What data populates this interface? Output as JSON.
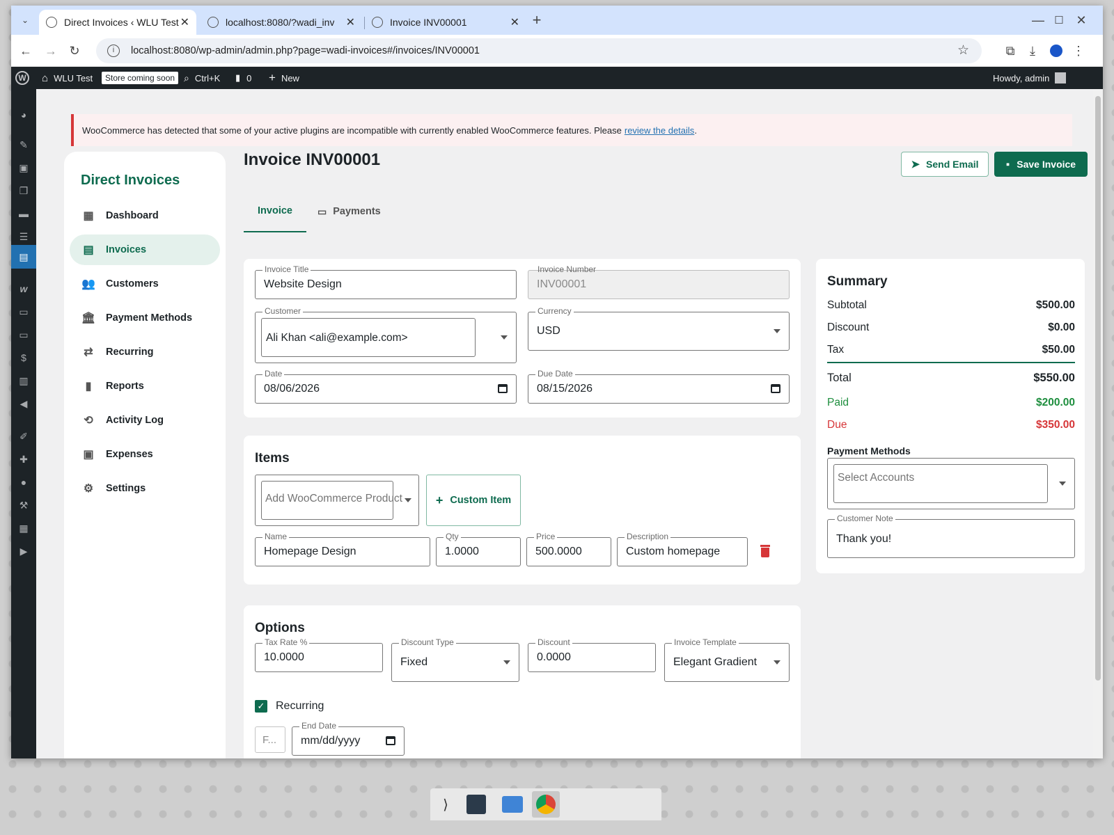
{
  "browser": {
    "tabs": [
      {
        "title": "Direct Invoices ‹ WLU Test"
      },
      {
        "title": "localhost:8080/?wadi_inv"
      },
      {
        "title": "Invoice INV00001"
      }
    ],
    "url": "localhost:8080/wp-admin/admin.php?page=wadi-invoices#/invoices/INV00001"
  },
  "adminbar": {
    "site_name": "WLU Test",
    "store_badge": "Store coming soon",
    "search_shortcut": "Ctrl+K",
    "comments_count": "0",
    "new_label": "New",
    "howdy": "Howdy, admin"
  },
  "notice": {
    "text": "WooCommerce has detected that some of your active plugins are incompatible with currently enabled WooCommerce features. Please",
    "link": "review the details",
    "suffix": "."
  },
  "sidebar": {
    "brand": "Direct Invoices",
    "items": [
      {
        "label": "Dashboard",
        "icon": "dashboard-icon"
      },
      {
        "label": "Invoices",
        "icon": "invoice-icon"
      },
      {
        "label": "Customers",
        "icon": "people-icon"
      },
      {
        "label": "Payment Methods",
        "icon": "bank-icon"
      },
      {
        "label": "Recurring",
        "icon": "repeat-icon"
      },
      {
        "label": "Reports",
        "icon": "bar-chart-icon"
      },
      {
        "label": "Activity Log",
        "icon": "history-icon"
      },
      {
        "label": "Expenses",
        "icon": "expenses-icon"
      },
      {
        "label": "Settings",
        "icon": "gear-icon"
      }
    ],
    "active_index": 1
  },
  "page": {
    "title": "Invoice INV00001",
    "send_email_label": "Send Email",
    "save_invoice_label": "Save Invoice",
    "tabs": [
      {
        "label": "Invoice"
      },
      {
        "label": "Payments"
      }
    ]
  },
  "details": {
    "invoice_title_label": "Invoice Title",
    "invoice_title_value": "Website Design",
    "invoice_number_label": "Invoice Number",
    "invoice_number_value": "INV00001",
    "customer_label": "Customer",
    "customer_value": "Ali Khan <ali@example.com>",
    "currency_label": "Currency",
    "currency_value": "USD",
    "date_label": "Date",
    "date_value": "08/06/2026",
    "due_date_label": "Due Date",
    "due_date_value": "08/15/2026"
  },
  "items": {
    "heading": "Items",
    "product_placeholder": "Add WooCommerce Product",
    "custom_item_label": "Custom Item",
    "row": {
      "name_label": "Name",
      "name_value": "Homepage Design",
      "qty_label": "Qty",
      "qty_value": "1.0000",
      "price_label": "Price",
      "price_value": "500.0000",
      "description_label": "Description",
      "description_value": "Custom homepage"
    }
  },
  "options": {
    "heading": "Options",
    "tax_rate_label": "Tax Rate %",
    "tax_rate_value": "10.0000",
    "discount_type_label": "Discount Type",
    "discount_type_value": "Fixed",
    "discount_label": "Discount",
    "discount_value": "0.0000",
    "template_label": "Invoice Template",
    "template_value": "Elegant Gradient",
    "recurring_label": "Recurring",
    "recurring_checked": true,
    "frequency_value": "F...",
    "end_date_label": "End Date",
    "end_date_placeholder": "mm/dd/yyyy"
  },
  "summary": {
    "heading": "Summary",
    "subtotal_label": "Subtotal",
    "subtotal_value": "$500.00",
    "discount_label": "Discount",
    "discount_value": "$0.00",
    "tax_label": "Tax",
    "tax_value": "$50.00",
    "total_label": "Total",
    "total_value": "$550.00",
    "paid_label": "Paid",
    "paid_value": "$200.00",
    "due_label": "Due",
    "due_value": "$350.00",
    "payment_methods_label": "Payment Methods",
    "payment_methods_placeholder": "Select Accounts",
    "customer_note_label": "Customer Note",
    "customer_note_value": "Thank you!"
  },
  "colors": {
    "brand_green": "#0e6b4f",
    "paid_green": "#1e8e3e",
    "due_red": "#d63638",
    "delete_red": "#d63638"
  }
}
